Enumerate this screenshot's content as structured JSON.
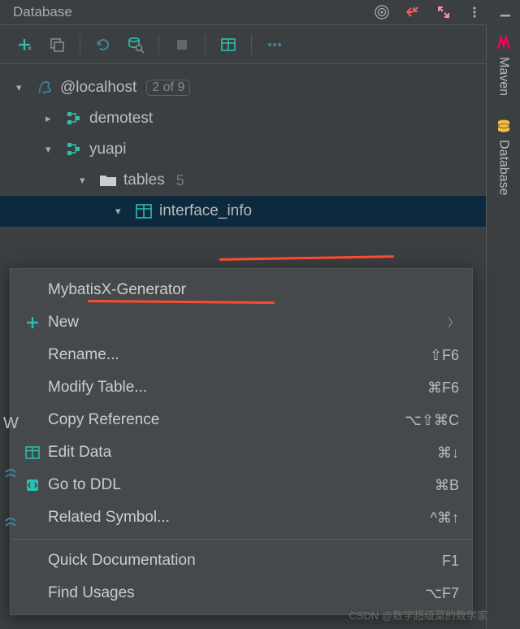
{
  "topBar": {
    "title": "Database"
  },
  "tree": {
    "connection": {
      "label": "@localhost",
      "count": "2 of 9"
    },
    "schemas": [
      {
        "label": "demotest",
        "expanded": false
      },
      {
        "label": "yuapi",
        "expanded": true,
        "children": [
          {
            "label": "tables",
            "count": "5",
            "expanded": true,
            "children": [
              {
                "label": "interface_info",
                "selected": true
              }
            ]
          }
        ]
      }
    ]
  },
  "contextMenu": {
    "items": [
      {
        "label": "MybatisX-Generator",
        "icon": "",
        "shortcut": ""
      },
      {
        "label": "New",
        "icon": "plus",
        "shortcut": "",
        "submenu": true
      },
      {
        "label": "Rename...",
        "icon": "",
        "shortcut": "⇧F6"
      },
      {
        "label": "Modify Table...",
        "icon": "",
        "shortcut": "⌘F6"
      },
      {
        "label": "Copy Reference",
        "icon": "",
        "shortcut": "⌥⇧⌘C"
      },
      {
        "label": "Edit Data",
        "icon": "table",
        "shortcut": "⌘↓"
      },
      {
        "label": "Go to DDL",
        "icon": "ddl",
        "shortcut": "⌘B"
      },
      {
        "label": "Related Symbol...",
        "icon": "",
        "shortcut": "^⌘↑"
      },
      {
        "sep": true
      },
      {
        "label": "Quick Documentation",
        "icon": "",
        "shortcut": "F1"
      },
      {
        "label": "Find Usages",
        "icon": "",
        "shortcut": "⌥F7"
      }
    ]
  },
  "rightTabs": [
    {
      "label": "Maven",
      "color": "#ff0055"
    },
    {
      "label": "Database",
      "color": "#f5bd41"
    }
  ],
  "watermark": "CSDN @数学超级菜的数学家",
  "colors": {
    "teal": "#2cbfae",
    "green": "#4caf50",
    "blue": "#3e86a0",
    "folder": "#c9ced6"
  }
}
